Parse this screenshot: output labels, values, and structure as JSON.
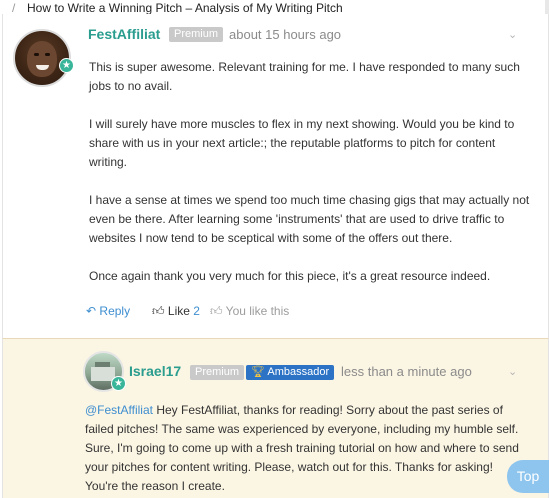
{
  "breadcrumb": {
    "separator": "/",
    "title": "How to Write a Winning Pitch – Analysis of My Writing Pitch"
  },
  "comment": {
    "author": "FestAffiliat",
    "badge": "Premium",
    "time": "about 15 hours ago",
    "menu_icon": "chevron-down-icon",
    "paragraphs": [
      "This is super awesome. Relevant training for me. I have responded to many such jobs to no avail.",
      "I will surely have more muscles to flex in my next showing. Would you be kind to share with us in your next article:; the reputable platforms to pitch for content writing.",
      "I have a sense at times we spend too much time chasing gigs that may actually not even be there. After learning some 'instruments' that are used to drive traffic to websites I now tend to be sceptical with some of the offers out there.",
      "Once again thank you very much for this piece, it's a great resource indeed."
    ],
    "actions": {
      "reply": "Reply",
      "like": "Like",
      "like_count": "2",
      "you_like": "You like this"
    }
  },
  "reply": {
    "author": "Israel17",
    "badge": "Premium",
    "role_badge": "Ambassador",
    "time": "less than a minute ago",
    "mention": "@FestAffiliat",
    "text": " Hey FestAffiliat, thanks for reading! Sorry about the past series of failed pitches! The same was experienced by everyone, including my humble self. Sure, I'm going to come up with a fresh training tutorial on how and where to send your pitches for content writing. Please, watch out for this. Thanks for asking! You're the reason I create."
  },
  "top_button": "Top",
  "colors": {
    "accent": "#2a9d8f",
    "link": "#3e8ed0",
    "ambassador": "#2c73c6",
    "reply_bg": "#fbf5e3"
  }
}
